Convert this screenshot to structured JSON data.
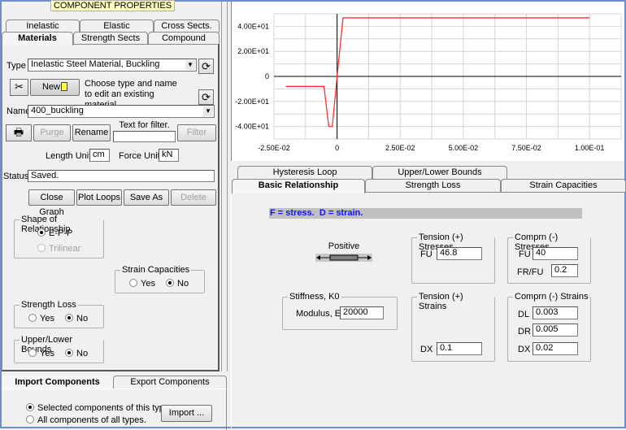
{
  "header": {
    "title": "COMPONENT PROPERTIES"
  },
  "left_tabs": {
    "row1": [
      "Inelastic",
      "Elastic",
      "Cross Sects."
    ],
    "row2": [
      "Materials",
      "Strength Sects",
      "Compound"
    ],
    "selected": "Materials"
  },
  "materials": {
    "type_label": "Type",
    "type_value": "Inelastic Steel Material, Buckling",
    "new_label": "New",
    "hint": "Choose type and name to edit an existing material.",
    "name_label": "Name",
    "name_value": "400_buckling",
    "purge_label": "Purge",
    "rename_label": "Rename",
    "filter_caption": "Text for filter.",
    "filter_value": "",
    "filter_label": "Filter",
    "length_unit_label": "Length Unit",
    "length_unit_value": "cm",
    "force_unit_label": "Force Unit",
    "force_unit_value": "kN",
    "status_label": "Status",
    "status_value": "Saved.",
    "close_graph_label": "Close Graph",
    "plot_loops_label": "Plot Loops",
    "save_as_label": "Save As",
    "delete_label": "Delete",
    "shape": {
      "title": "Shape of Relationship",
      "options": [
        "E-P-P",
        "Trilinear"
      ],
      "selected": "E-P-P"
    },
    "strain_capacities": {
      "title": "Strain Capacities",
      "yes": "Yes",
      "no": "No",
      "selected": "No"
    },
    "strength_loss": {
      "title": "Strength Loss",
      "yes": "Yes",
      "no": "No",
      "selected": "No"
    },
    "bounds": {
      "title": "Upper/Lower Bounds",
      "yes": "Yes",
      "no": "No",
      "selected": "No"
    }
  },
  "bottom": {
    "tabs": [
      "Import Components",
      "Export Components"
    ],
    "selected": "Import Components",
    "options": [
      "Selected components of this type.",
      "All components of all types."
    ],
    "selected_option": 0,
    "import_label": "Import ..."
  },
  "chart_data": {
    "type": "line",
    "xlim": [
      -0.025,
      0.1125
    ],
    "ylim": [
      -50,
      50
    ],
    "grid": true,
    "x_ticks": [
      "-2.50E-02",
      "0",
      "2.50E-02",
      "5.00E-02",
      "7.50E-02",
      "1.00E-01"
    ],
    "x_tick_values": [
      -0.025,
      0,
      0.025,
      0.05,
      0.075,
      0.1
    ],
    "y_ticks": [
      "4.00E+01",
      "2.00E+01",
      "0",
      "-2.00E+01",
      "-4.00E+01"
    ],
    "y_tick_values": [
      40,
      20,
      0,
      -20,
      -40
    ],
    "series": [
      {
        "color": "#ff3030",
        "x": [
          -0.0203,
          -0.0052,
          -0.0033,
          -0.0019,
          0,
          0.00234,
          0.1
        ],
        "y": [
          -8,
          -8,
          -40,
          -40,
          0,
          46.8,
          46.8
        ]
      }
    ]
  },
  "right_tabs": {
    "row1": [
      "Hysteresis Loop",
      "Upper/Lower Bounds"
    ],
    "row2": [
      "Basic Relationship",
      "Strength Loss",
      "Strain Capacities"
    ],
    "selected": "Basic Relationship"
  },
  "basic": {
    "legend": "F = stress.  D = strain.",
    "legend_color": "#1010ff",
    "positive_label": "Positive",
    "tension_stresses": {
      "title": "Tension (+) Stresses",
      "fu_label": "FU",
      "fu": "46.8"
    },
    "compr_stresses": {
      "title": "Comprn (-) Stresses",
      "fu_label": "FU",
      "fu": "40",
      "frfu_label": "FR/FU",
      "frfu": "0.2"
    },
    "stiffness": {
      "title": "Stiffness, K0",
      "modulus_label": "Modulus, E",
      "modulus": "20000"
    },
    "tension_strains": {
      "title": "Tension (+) Strains",
      "dx_label": "DX",
      "dx": "0.1"
    },
    "compr_strains": {
      "title": "Comprn (-) Strains",
      "dl_label": "DL",
      "dl": "0.003",
      "dr_label": "DR",
      "dr": "0.005",
      "dx_label": "DX",
      "dx": "0.02"
    }
  }
}
